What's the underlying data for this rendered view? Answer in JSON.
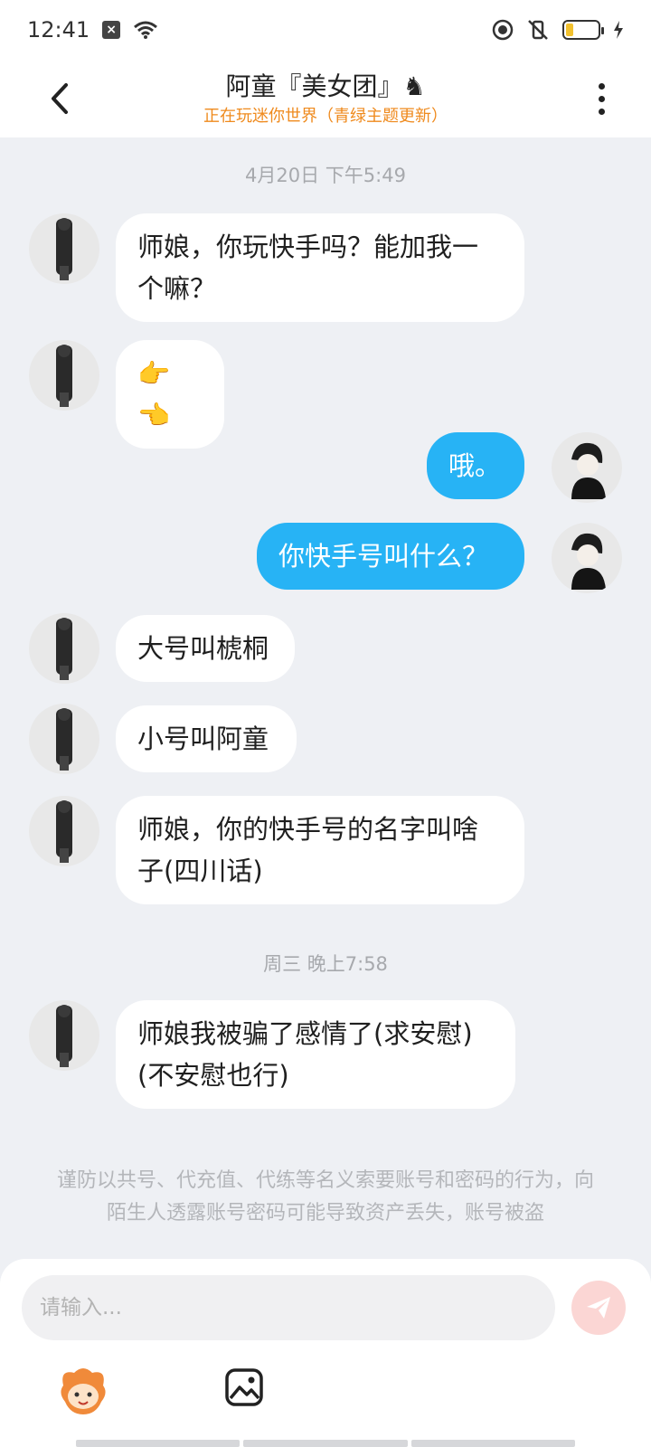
{
  "status_bar": {
    "time": "12:41",
    "icons": [
      "notification-x-icon",
      "wifi-icon",
      "focus-icon",
      "mute-vibrate-icon",
      "battery-icon",
      "charging-icon"
    ]
  },
  "header": {
    "title": "阿童『美女团』♞",
    "subtitle": "正在玩迷你世界（青绿主题更新）",
    "back_icon": "back-chevron-icon",
    "more_icon": "more-vertical-icon"
  },
  "timestamps": [
    "4月20日 下午5:49",
    "周三 晚上7:58"
  ],
  "messages": [
    {
      "side": "in",
      "text": "师娘，你玩快手吗？能加我一\n个嘛？"
    },
    {
      "side": "in",
      "text": "👉👈"
    },
    {
      "side": "out",
      "text": "哦。"
    },
    {
      "side": "out",
      "text": "你快手号叫什么？"
    },
    {
      "side": "in",
      "text": "大号叫椃桐"
    },
    {
      "side": "in",
      "text": "小号叫阿童"
    },
    {
      "side": "in",
      "text": "师娘，你的快手号的名字叫啥\n子(四川话)"
    },
    {
      "side": "in",
      "text": "师娘我被骗了感情了(求安慰)\n(不安慰也行)"
    }
  ],
  "notice": "谨防以共号、代充值、代练等名义索要账号和密码的行为，向陌生人透露账号密码可能导致资产丢失，账号被盗",
  "input": {
    "placeholder": "请输入...",
    "value": ""
  },
  "colors": {
    "outgoing_bubble": "#27b3f5",
    "incoming_bubble": "#ffffff",
    "subtitle": "#ef8a1d",
    "send_button": "#fbd6d4",
    "background": "#eef0f4"
  }
}
